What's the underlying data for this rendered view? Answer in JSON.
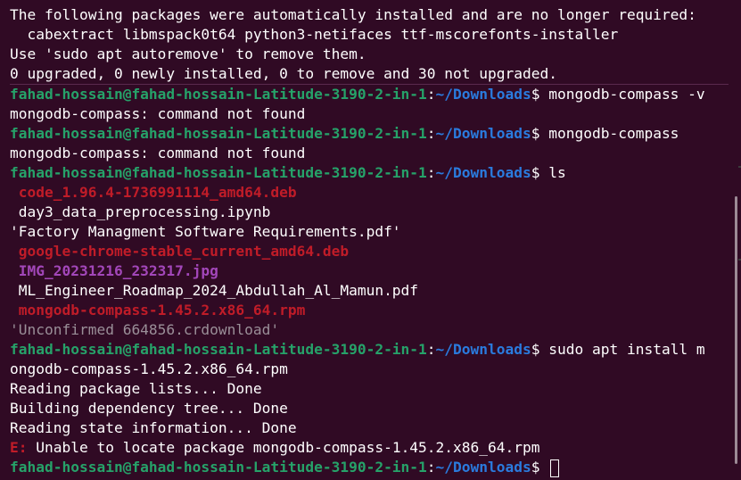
{
  "prompt": {
    "user_host": "fahad-hossain@fahad-hossain-Latitude-3190-2-in-1",
    "colon": ":",
    "path": "~/Downloads",
    "dollar": "$"
  },
  "output": {
    "autoremove_1": "The following packages were automatically installed and are no longer required:",
    "autoremove_2": "  cabextract libmspack0t64 python3-netifaces ttf-mscorefonts-installer",
    "autoremove_3": "Use 'sudo apt autoremove' to remove them.",
    "autoremove_4": "0 upgraded, 0 newly installed, 0 to remove and 30 not upgraded.",
    "not_found_1": "mongodb-compass: command not found",
    "not_found_2": "mongodb-compass: command not found",
    "cmd_wrap": "ongodb-compass-1.45.2.x86_64.rpm",
    "reading_lists": "Reading package lists... Done",
    "building_tree": "Building dependency tree... Done",
    "reading_state": "Reading state information... Done",
    "error_prefix": "E:",
    "error_message": " Unable to locate package mongodb-compass-1.45.2.x86_64.rpm"
  },
  "commands": {
    "cmd1": " mongodb-compass -v",
    "cmd2": " mongodb-compass",
    "cmd3": " ls",
    "cmd4": " sudo apt install m"
  },
  "ls_files": {
    "f1": " code_1.96.4-1736991114_amd64.deb",
    "f2": " day3_data_preprocessing.ipynb",
    "f3": "'Factory Managment Software Requirements.pdf'",
    "f4": " google-chrome-stable_current_amd64.deb",
    "f5": " IMG_20231216_232317.jpg",
    "f6": " ML_Engineer_Roadmap_2024_Abdullah_Al_Mamun.pdf",
    "f7": " mongodb-compass-1.45.2.x86_64.rpm",
    "f8": "'Unconfirmed 664856.crdownload'"
  },
  "colors": {
    "background": "#300a24",
    "prompt_user": "#26a269",
    "prompt_path": "#2a7bde",
    "deb_rpm_file": "#c01c28",
    "image_file": "#a347ba",
    "partial_download": "#9a8f98",
    "error": "#c01c28"
  }
}
